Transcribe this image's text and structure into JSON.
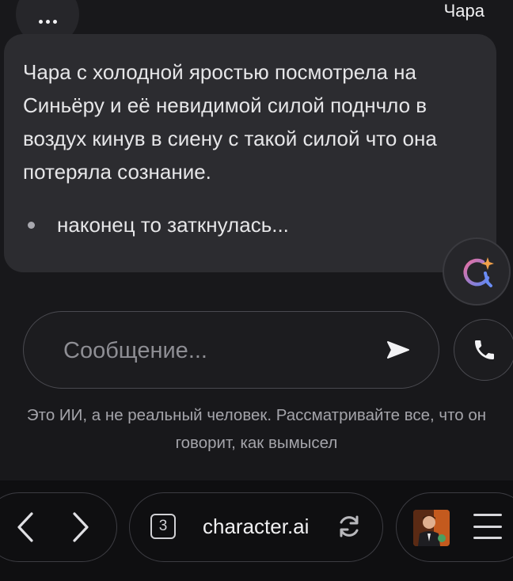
{
  "header": {
    "character_name": "Чара"
  },
  "message": {
    "paragraph": "Чара с холодной яростью посмотрела на Синьёру и её невидимой силой поднчло в воздух кинув в сиену с такой силой что она потеряла сознание.",
    "bullet": "наконец то заткнулась..."
  },
  "composer": {
    "placeholder": "Сообщение..."
  },
  "disclaimer": {
    "line1": "Это ИИ, а не реальный человек. Рассматривайте все, что он",
    "line2": "говорит, как вымысел"
  },
  "browser": {
    "tab_count": "3",
    "url": "character.ai"
  },
  "icons": {
    "more": "more-dots-icon",
    "ai_badge": "ai-sparkle-icon",
    "send": "send-arrow-icon",
    "call": "phone-icon",
    "back": "chevron-left-icon",
    "forward": "chevron-right-icon",
    "reload": "reload-icon",
    "menu": "hamburger-menu-icon"
  },
  "colors": {
    "background": "#18181b",
    "bubble": "#2c2c30",
    "browser_bar": "#0f0f11",
    "ai_badge_gradient": [
      "#e06b9a",
      "#6a8cf5"
    ]
  }
}
